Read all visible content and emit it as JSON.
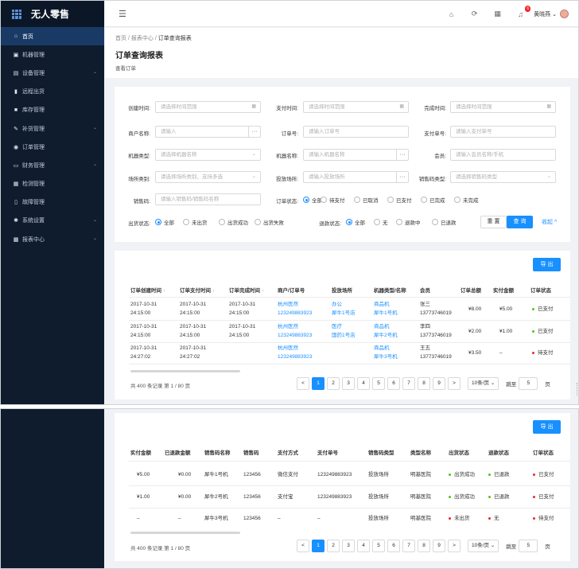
{
  "app": {
    "name": "无人零售"
  },
  "sidebar": {
    "items": [
      {
        "label": "首页",
        "icon": "⌂",
        "arrow": ""
      },
      {
        "label": "机器管理",
        "icon": "▣",
        "arrow": ""
      },
      {
        "label": "设备管理",
        "icon": "▤",
        "arrow": "⌄"
      },
      {
        "label": "远程出货",
        "icon": "▮",
        "arrow": ""
      },
      {
        "label": "库存管理",
        "icon": "■",
        "arrow": ""
      },
      {
        "label": "补货管理",
        "icon": "✎",
        "arrow": "⌄"
      },
      {
        "label": "订单管理",
        "icon": "◉",
        "arrow": ""
      },
      {
        "label": "财务管理",
        "icon": "▭",
        "arrow": "⌄"
      },
      {
        "label": "检测管理",
        "icon": "▦",
        "arrow": ""
      },
      {
        "label": "故障管理",
        "icon": "▯",
        "arrow": ""
      },
      {
        "label": "系统设置",
        "icon": "✱",
        "arrow": "⌄"
      },
      {
        "label": "报表中心",
        "icon": "▩",
        "arrow": "⌄"
      }
    ]
  },
  "topbar": {
    "notif_count": "6",
    "user": "黄晓燕",
    "caret": "⌄"
  },
  "header": {
    "breadcrumb": [
      "首页",
      "报表中心",
      "订单查询报表"
    ],
    "sep": "/",
    "title": "订单查询报表",
    "subtitle": "查看订单"
  },
  "filters": {
    "create_time": {
      "label": "创建时间:",
      "placeholder": "请选择时间范围"
    },
    "pay_time": {
      "label": "支付时间:",
      "placeholder": "请选择时间范围"
    },
    "finish_time": {
      "label": "完成时间:",
      "placeholder": "请选择时间范围"
    },
    "merchant": {
      "label": "商户名称:",
      "placeholder": "请输入"
    },
    "order_no": {
      "label": "订单号:",
      "placeholder": "请输入订单号"
    },
    "pay_no": {
      "label": "支付单号:",
      "placeholder": "请输入支付单号"
    },
    "machine_type": {
      "label": "机器类型:",
      "placeholder": "请选择机器名称"
    },
    "machine_name": {
      "label": "机器名称:",
      "placeholder": "请输入机器名称"
    },
    "member": {
      "label": "会员:",
      "placeholder": "请输入会员名称/手机"
    },
    "site_type": {
      "label": "场所类别:",
      "placeholder": "请选择场所类别、支持多选"
    },
    "site": {
      "label": "投放场所:",
      "placeholder": "请输入投放场所"
    },
    "code_type": {
      "label": "销售码类型:",
      "placeholder": "请选择销售码类型"
    },
    "code": {
      "label": "销售码:",
      "placeholder": "请输入销售码/销售码名称"
    },
    "order_status": {
      "label": "订单状态:",
      "options": [
        "全部",
        "待支付",
        "已取消",
        "已支付",
        "已完成",
        "未完成"
      ],
      "selected": "全部"
    },
    "ship_status": {
      "label": "出货状态:",
      "options": [
        "全部",
        "未出货",
        "出货成功",
        "出货失败"
      ],
      "selected": "全部"
    },
    "refund_status": {
      "label": "退款状态:",
      "options": [
        "全部",
        "无",
        "退款中",
        "已退款"
      ],
      "selected": "全部"
    },
    "reset": "重 置",
    "query": "查 询",
    "collapse": "收起 ^"
  },
  "export": "导 出",
  "table1": {
    "headers": [
      "订单创建时间",
      "订单支付时间",
      "订单完成时间",
      "商户/订单号",
      "投放场所",
      "机器类型/名称",
      "会员",
      "订单总额",
      "实付金额",
      "订单状态"
    ],
    "sortable": [
      true,
      true,
      true,
      false,
      false,
      false,
      false,
      false,
      false,
      false
    ],
    "sort_icon": "↑",
    "rows": [
      {
        "create": [
          "2017-10-31",
          "24:15:00"
        ],
        "pay": [
          "2017-10-31",
          "24:15:00"
        ],
        "finish": [
          "2017-10-31",
          "24:15:00"
        ],
        "order": [
          "杭州医然",
          "123249883923"
        ],
        "site": [
          "办公",
          "犀牛1号店"
        ],
        "machine": [
          "商品机",
          "犀牛1号机"
        ],
        "member": [
          "张三",
          "13773746019"
        ],
        "total": "¥8.00",
        "paid": "¥5.00",
        "status": "已支付",
        "status_color": "#52c41a"
      },
      {
        "create": [
          "2017-10-31",
          "24:15:00"
        ],
        "pay": [
          "2017-10-31",
          "24:15:00"
        ],
        "finish": [
          "2017-10-31",
          "24:15:00"
        ],
        "order": [
          "杭州医然",
          "123249883923"
        ],
        "site": [
          "医疗",
          "国药1号店"
        ],
        "machine": [
          "商品机",
          "犀牛2号机"
        ],
        "member": [
          "李四",
          "13773746019"
        ],
        "total": "¥2.00",
        "paid": "¥1.00",
        "status": "已支付",
        "status_color": "#52c41a"
      },
      {
        "create": [
          "2017-10-31",
          "24:27:02"
        ],
        "pay": [
          "2017-10-31",
          "24:27:02"
        ],
        "finish": [
          "",
          ""
        ],
        "order": [
          "杭州医然",
          "123249883923"
        ],
        "site": [
          "",
          ""
        ],
        "machine": [
          "商品机",
          "犀牛3号机"
        ],
        "member": [
          "王五",
          "13773746019"
        ],
        "total": "¥3.50",
        "paid": "–",
        "status": "待支付",
        "status_color": "#f5222d"
      }
    ]
  },
  "table2": {
    "headers": [
      "实付金额",
      "已退款金额",
      "销售码名称",
      "销售码",
      "支付方式",
      "支付单号",
      "销售码类型",
      "类型名称",
      "出货状态",
      "退款状态",
      "订单状态"
    ],
    "rows": [
      {
        "paid": "¥5.00",
        "refunded": "¥0.00",
        "code_name": "犀牛1号机",
        "code": "123456",
        "pay_method": "微信支付",
        "pay_no": "123249883923",
        "code_type": "投放场所",
        "type_name": "明基医院",
        "ship": "出货成功",
        "ship_color": "#52c41a",
        "refund": "已退款",
        "refund_color": "#52c41a",
        "status": "已支付",
        "status_color": "#f5222d"
      },
      {
        "paid": "¥1.00",
        "refunded": "¥0.00",
        "code_name": "犀牛2号机",
        "code": "123456",
        "pay_method": "支付宝",
        "pay_no": "123249883923",
        "code_type": "投放场所",
        "type_name": "明基医院",
        "ship": "出货成功",
        "ship_color": "#52c41a",
        "refund": "已退款",
        "refund_color": "#52c41a",
        "status": "已支付",
        "status_color": "#f5222d"
      },
      {
        "paid": "–",
        "refunded": "–",
        "code_name": "犀牛3号机",
        "code": "123456",
        "pay_method": "–",
        "pay_no": "–",
        "code_type": "投放场所",
        "type_name": "明基医院",
        "ship": "未出货",
        "ship_color": "#f5222d",
        "refund": "无",
        "refund_color": "#f5222d",
        "status": "待支付",
        "status_color": "#f5222d"
      }
    ]
  },
  "pagination": {
    "total": "共 400 条记录 第 1 / 80 页",
    "pages": [
      "1",
      "2",
      "3",
      "4",
      "5",
      "6",
      "7",
      "8",
      "9"
    ],
    "current": "1",
    "prev": "<",
    "next": ">",
    "size": "10条/页 ⌄",
    "jump_label": "跳至",
    "jump_value": "5",
    "unit": "页"
  }
}
